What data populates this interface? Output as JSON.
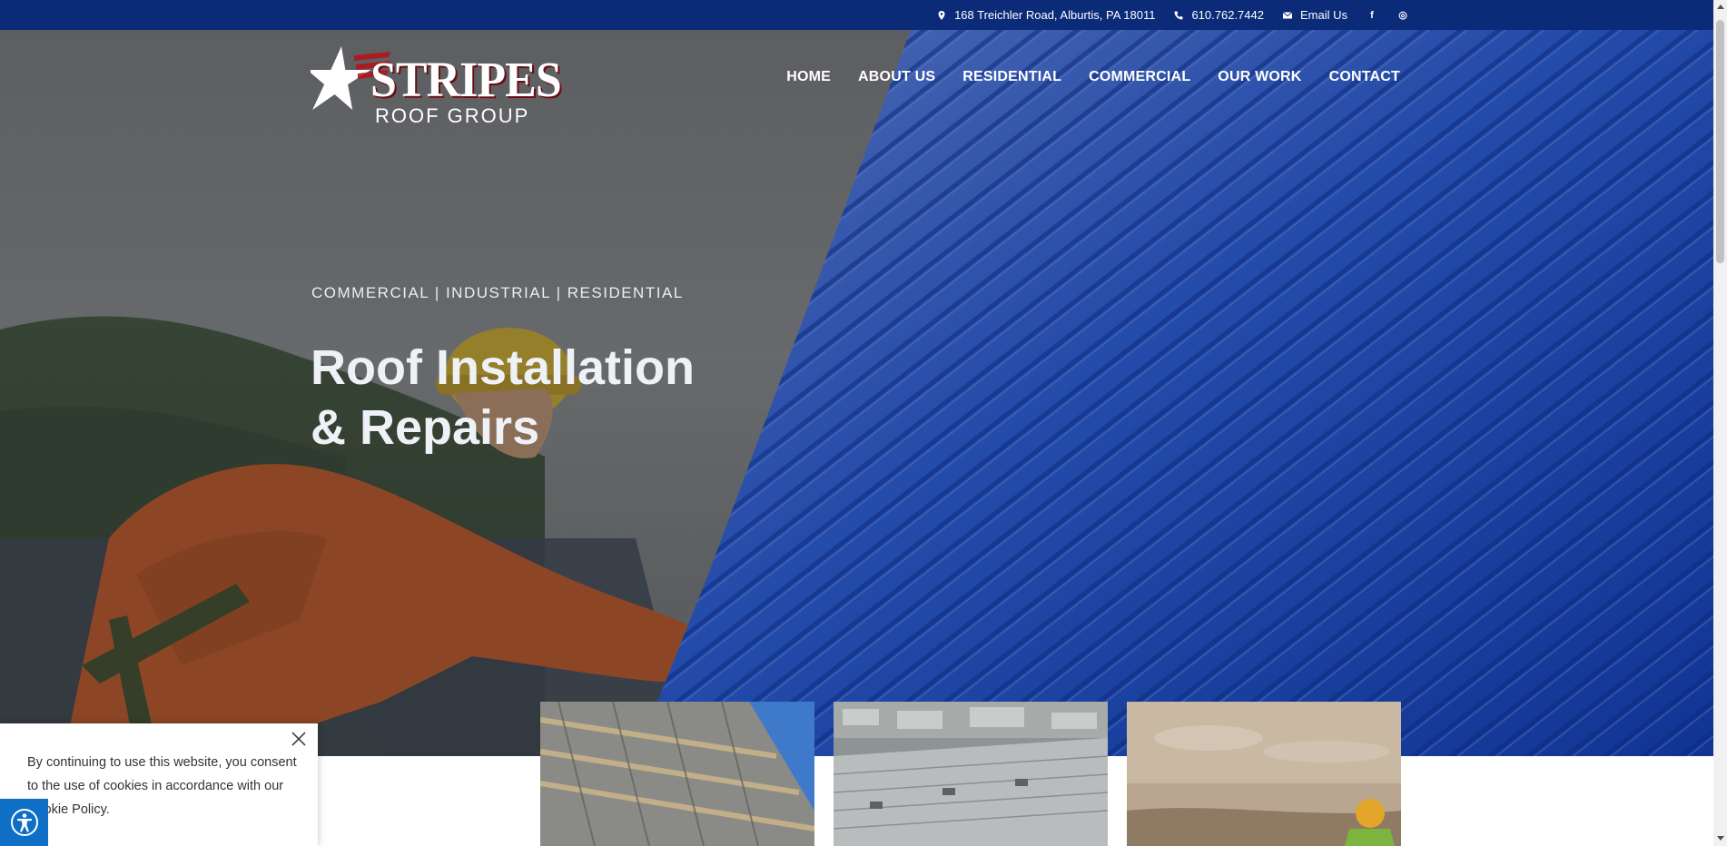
{
  "topbar": {
    "address": "168 Treichler Road, Alburtis, PA 18011",
    "phone": "610.762.7442",
    "email_label": "Email Us",
    "social": [
      {
        "icon": "facebook-icon",
        "glyph": "f"
      },
      {
        "icon": "instagram-icon",
        "glyph": "◎"
      }
    ]
  },
  "logo": {
    "wordmark": "STRIPES",
    "subtitle": "ROOF GROUP"
  },
  "nav": {
    "items": [
      "HOME",
      "ABOUT US",
      "RESIDENTIAL",
      "COMMERCIAL",
      "OUR WORK",
      "CONTACT"
    ]
  },
  "hero": {
    "eyebrow": "COMMERCIAL | INDUSTRIAL | RESIDENTIAL",
    "headline_line1": "Roof Installation",
    "headline_line2": "& Repairs"
  },
  "cookie": {
    "text": "By continuing to use this website, you consent to the use of cookies in accordance with our Cookie Policy."
  },
  "colors": {
    "topbar": "#0b2a78",
    "brand_blue": "#1c45a8",
    "accent_red": "#b3141c",
    "accessibility": "#0f6ec6"
  }
}
